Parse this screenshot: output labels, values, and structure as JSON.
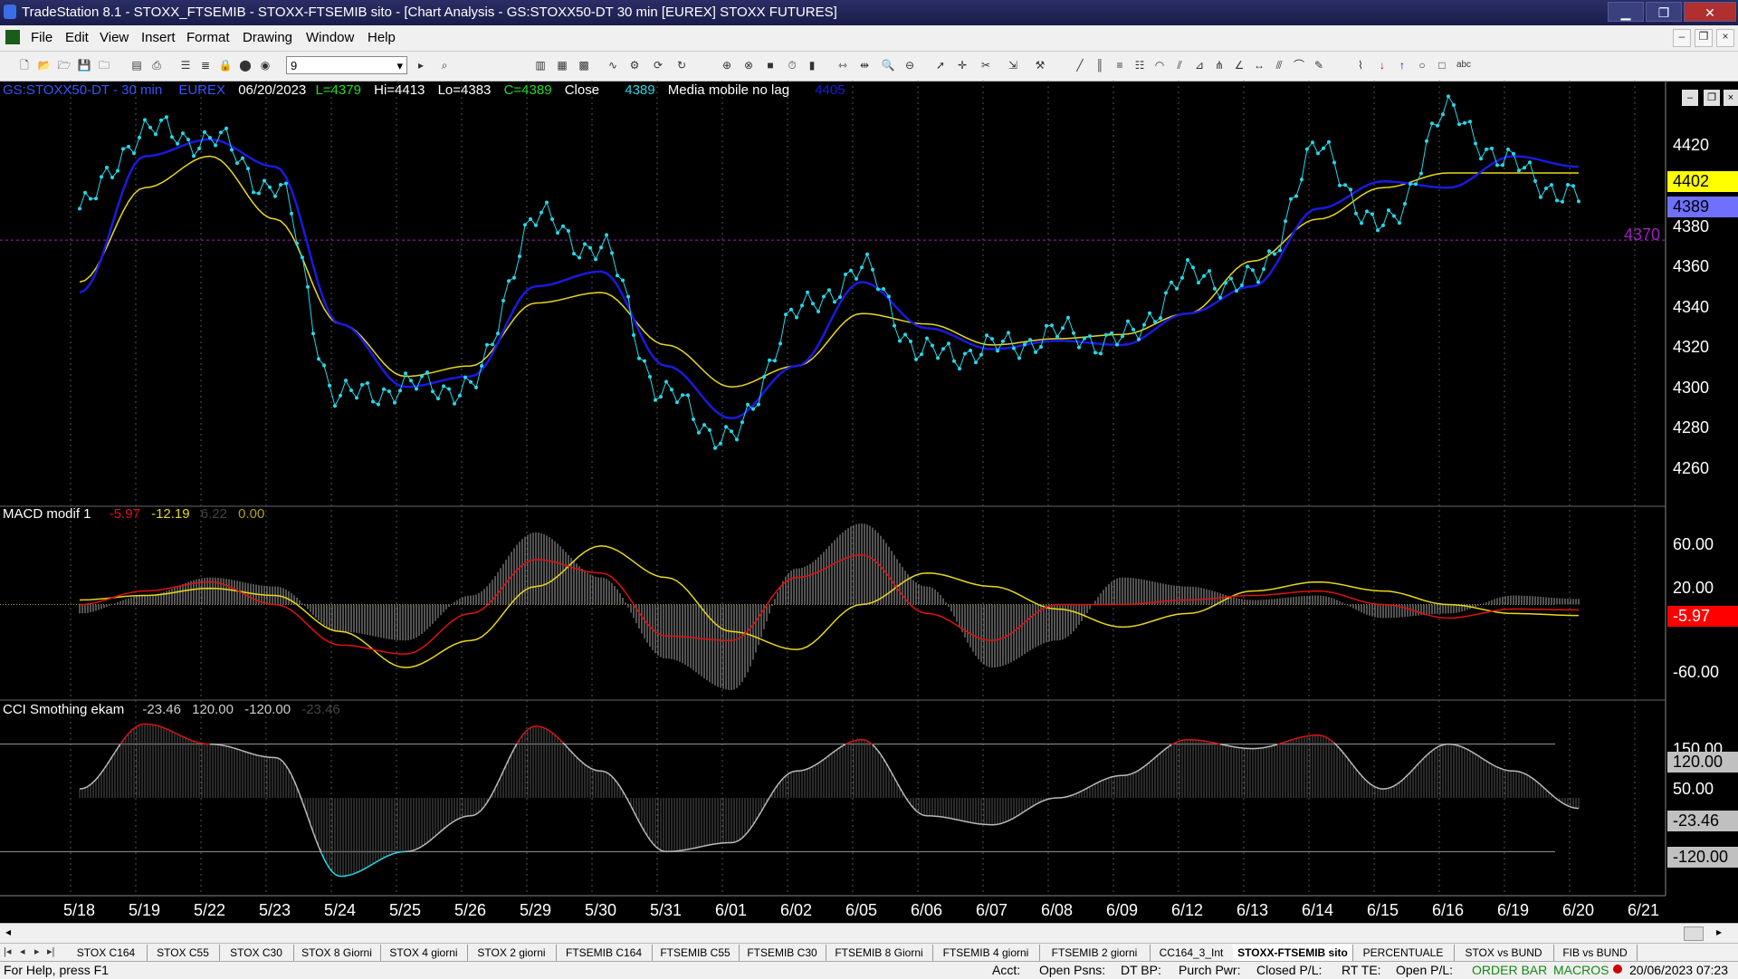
{
  "window": {
    "title": "TradeStation 8.1 - STOXX_FTSEMIB - STOXX-FTSEMIB sito - [Chart Analysis - GS:STOXX50-DT  30 min  [EUREX] STOXX FUTURES]",
    "minimize": "▁",
    "restore": "❐",
    "close": "✕"
  },
  "menu": {
    "items": [
      "File",
      "Edit",
      "View",
      "Insert",
      "Format",
      "Drawing",
      "Window",
      "Help"
    ],
    "mdi_min": "–",
    "mdi_restore": "❐",
    "mdi_close": "×"
  },
  "toolbar": {
    "interval_value": "9"
  },
  "header": {
    "symbol": "GS:STOXX50-DT - 30 min",
    "exchange": "EUREX",
    "date": "06/20/2023",
    "last": "L=4379",
    "high": "Hi=4413",
    "low": "Lo=4383",
    "close": "C=4389",
    "close_label": "Close",
    "close_value": "4389",
    "ma_label": "Media mobile no lag",
    "ma_value": "4405"
  },
  "macd_header": {
    "name": "MACD modif 1",
    "v1": "-5.97",
    "v2": "-12.19",
    "v3": "6.22",
    "v4": "0.00"
  },
  "cci_header": {
    "name": "CCI Smothing ekam",
    "v1": "-23.46",
    "v2": "120.00",
    "v3": "-120.00",
    "v4": "-23.46"
  },
  "price_axis": {
    "labels": [
      "4420",
      "4380",
      "4360",
      "4340",
      "4320",
      "4300",
      "4280",
      "4260"
    ],
    "tag_yellow": "4402",
    "tag_blue": "4389",
    "line_label": "4370"
  },
  "macd_axis": {
    "labels": [
      "60.00",
      "20.00",
      "-60.00"
    ],
    "tag_red": "-5.97"
  },
  "cci_axis": {
    "labels": [
      "150.00",
      "50.00"
    ],
    "tag_120": "120.00",
    "tag_cur": "-23.46",
    "tag_m120": "-120.00"
  },
  "time_axis": {
    "labels": [
      "5/18",
      "5/19",
      "5/22",
      "5/23",
      "5/24",
      "5/25",
      "5/26",
      "5/29",
      "5/30",
      "5/31",
      "6/01",
      "6/02",
      "6/05",
      "6/06",
      "6/07",
      "6/08",
      "6/09",
      "6/12",
      "6/13",
      "6/14",
      "6/15",
      "6/16",
      "6/19",
      "6/20",
      "6/21"
    ]
  },
  "tabs": [
    "STOX C164",
    "STOX C55",
    "STOX  C30",
    "STOX  8 Giorni",
    "STOX 4 giorni",
    "STOX  2 giorni",
    "FTSEMIB C164",
    "FTSEMIB C55",
    "FTSEMIB C30",
    "FTSEMIB  8 Giorni",
    "FTSEMIB  4 giorni",
    "FTSEMIB  2 giorni",
    "CC164_3_Int",
    "STOXX-FTSEMIB sito",
    "PERCENTUALE",
    "STOX vs BUND",
    "FIB vs BUND"
  ],
  "status": {
    "help": "For Help, press F1",
    "acct": "Acct:",
    "open_psns": "Open Psns:",
    "dt_bp": "DT BP:",
    "purch_pwr": "Purch Pwr:",
    "closed_pl": "Closed P/L:",
    "rt_te": "RT TE:",
    "open_pl": "Open P/L:",
    "order_bar": "ORDER BAR",
    "macros": "MACROS",
    "datetime": "20/06/2023 07:23"
  },
  "colors": {
    "price_dots": "#27d8e8",
    "ma_blue": "#1a1adf",
    "ma_yellow": "#e8d81a",
    "macd_red": "#e01010",
    "cci_red": "#e01010",
    "cci_cyan": "#27d8e8",
    "label_green": "#22dd22",
    "label_cyan": "#27d8e8",
    "label_blue": "#3355ff",
    "purple": "#a020c0"
  },
  "chart_data": [
    {
      "type": "line",
      "title": "GS:STOXX50-DT - 30 min",
      "x": [
        "5/18",
        "5/19",
        "5/22",
        "5/23",
        "5/24",
        "5/25",
        "5/26",
        "5/29",
        "5/30",
        "5/31",
        "6/01",
        "6/02",
        "6/05",
        "6/06",
        "6/07",
        "6/08",
        "6/09",
        "6/12",
        "6/13",
        "6/14",
        "6/15",
        "6/16",
        "6/19",
        "6/20"
      ],
      "series": [
        {
          "name": "Close",
          "values": [
            4385,
            4422,
            4418,
            4395,
            4295,
            4300,
            4300,
            4380,
            4365,
            4295,
            4275,
            4335,
            4355,
            4315,
            4318,
            4325,
            4322,
            4352,
            4350,
            4412,
            4375,
            4430,
            4405,
            4389
          ]
        },
        {
          "name": "Media mobile no lag",
          "values": [
            4345,
            4410,
            4418,
            4405,
            4330,
            4300,
            4305,
            4348,
            4355,
            4310,
            4285,
            4310,
            4350,
            4328,
            4318,
            4322,
            4320,
            4335,
            4348,
            4385,
            4398,
            4395,
            4410,
            4405
          ]
        },
        {
          "values": [
            4350,
            4395,
            4410,
            4380,
            4330,
            4305,
            4310,
            4340,
            4345,
            4320,
            4300,
            4310,
            4335,
            4330,
            4320,
            4323,
            4325,
            4335,
            4360,
            4380,
            4395,
            4402,
            4402,
            4402
          ]
        }
      ],
      "ylim": [
        4250,
        4440
      ],
      "hline": 4370
    },
    {
      "type": "line",
      "title": "MACD modif 1",
      "x": [
        "5/18",
        "5/19",
        "5/22",
        "5/23",
        "5/24",
        "5/25",
        "5/26",
        "5/29",
        "5/30",
        "5/31",
        "6/01",
        "6/02",
        "6/05",
        "6/06",
        "6/07",
        "6/08",
        "6/09",
        "6/12",
        "6/13",
        "6/14",
        "6/15",
        "6/16",
        "6/19",
        "6/20"
      ],
      "series": [
        {
          "values": [
            0,
            15,
            25,
            0,
            -45,
            -55,
            -10,
            50,
            35,
            -35,
            -40,
            30,
            55,
            -10,
            -40,
            0,
            0,
            5,
            10,
            15,
            0,
            -15,
            -5,
            -5.97
          ]
        },
        {
          "values": [
            5,
            10,
            18,
            10,
            -30,
            -70,
            -40,
            20,
            65,
            30,
            -30,
            -50,
            0,
            35,
            20,
            -5,
            -25,
            -10,
            15,
            25,
            15,
            0,
            -10,
            -12.19
          ]
        },
        {
          "values": [
            -10,
            10,
            30,
            20,
            -30,
            -40,
            10,
            80,
            30,
            -60,
            -95,
            40,
            90,
            20,
            -70,
            -40,
            30,
            20,
            5,
            10,
            -15,
            -10,
            10,
            6.22
          ]
        }
      ],
      "ylim": [
        -90,
        95
      ]
    },
    {
      "type": "line",
      "title": "CCI Smothing ekam",
      "x": [
        "5/18",
        "5/19",
        "5/22",
        "5/23",
        "5/24",
        "5/25",
        "5/26",
        "5/29",
        "5/30",
        "5/31",
        "6/01",
        "6/02",
        "6/05",
        "6/06",
        "6/07",
        "6/08",
        "6/09",
        "6/12",
        "6/13",
        "6/14",
        "6/15",
        "6/16",
        "6/19",
        "6/20"
      ],
      "series": [
        {
          "values": [
            20,
            165,
            120,
            90,
            -175,
            -120,
            -40,
            160,
            60,
            -120,
            -100,
            60,
            130,
            -40,
            -60,
            0,
            50,
            130,
            110,
            140,
            20,
            120,
            60,
            -23.46
          ]
        }
      ],
      "ylim": [
        -190,
        190
      ],
      "hlines": [
        120,
        -120
      ]
    }
  ]
}
